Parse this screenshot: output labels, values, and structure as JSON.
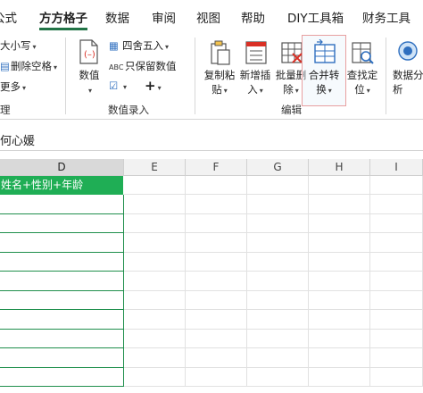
{
  "tabs": [
    {
      "label": "公式",
      "active": false
    },
    {
      "label": "方方格子",
      "active": true
    },
    {
      "label": "数据",
      "active": false
    },
    {
      "label": "审阅",
      "active": false
    },
    {
      "label": "视图",
      "active": false
    },
    {
      "label": "帮助",
      "active": false
    },
    {
      "label": "DIY工具箱",
      "active": false
    },
    {
      "label": "财务工具",
      "active": false
    }
  ],
  "ribbon": {
    "left_items": {
      "case": "大小写",
      "delete_space": "删除空格",
      "more": "更多",
      "group_tail": "理"
    },
    "numeric": {
      "value_label": "数值",
      "round": "四舍五入",
      "keep_value": "只保留数值",
      "abc_prefix": "ABC",
      "group_label": "数值录入"
    },
    "edit": {
      "copy_paste": [
        "复制粘",
        "贴"
      ],
      "insert": [
        "新增插",
        "入"
      ],
      "batch_delete": [
        "批量删",
        "除"
      ],
      "merge_convert": [
        "合并转",
        "换"
      ],
      "find_locate": [
        "查找定",
        "位"
      ],
      "group_label": "编辑"
    },
    "data_analysis": [
      "数据分",
      "析"
    ]
  },
  "formula_bar": {
    "content": "何心媛"
  },
  "grid": {
    "columns": [
      "D",
      "E",
      "F",
      "G",
      "H",
      "I"
    ],
    "selected_column": "D",
    "header_cell": "姓名+性别+年龄"
  },
  "colors": {
    "accent_green": "#217346",
    "header_fill": "#1fae55",
    "red_icon": "#d93025",
    "blue_icon": "#2f6fbf"
  }
}
